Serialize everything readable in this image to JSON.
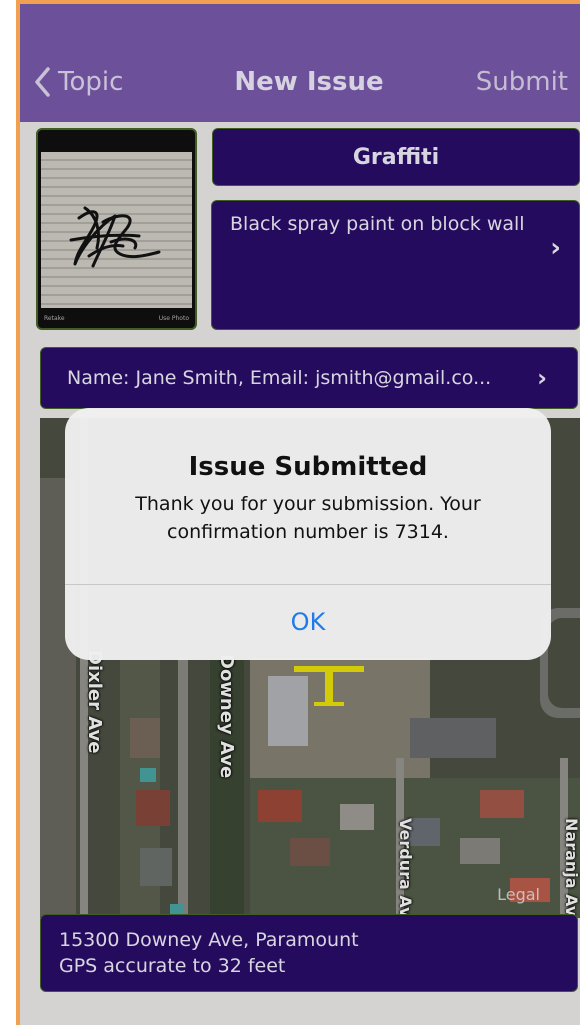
{
  "nav": {
    "back_label": "Topic",
    "title": "New Issue",
    "submit_label": "Submit"
  },
  "photo": {
    "retake_label": "Retake",
    "use_label": "Use Photo"
  },
  "issue": {
    "category": "Graffiti",
    "description": "Black spray paint on block wall",
    "contact": "Name: Jane Smith, Email: jsmith@gmail.co..."
  },
  "map": {
    "streets": [
      "Dixler Ave",
      "Downey Ave",
      "Verdura Av",
      "Naranja Av"
    ],
    "credit": "Legal"
  },
  "location": {
    "address": "15300 Downey Ave, Paramount",
    "accuracy": "GPS accurate to 32 feet"
  },
  "alert": {
    "title": "Issue Submitted",
    "message": "Thank you for your submission. Your confirmation number is 7314.",
    "ok_label": "OK"
  },
  "colors": {
    "navbar": "#7b5cb0",
    "panel": "#2b0d6a",
    "link": "#1f7bea",
    "pin": "#f2e80a"
  },
  "icons": [
    "chevron-left-icon",
    "chevron-right-icon",
    "map-pin-icon"
  ]
}
